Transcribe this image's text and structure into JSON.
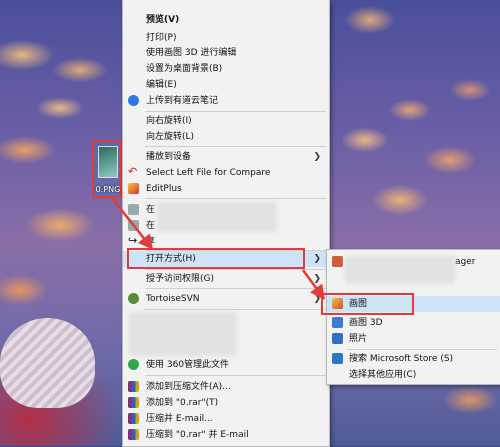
{
  "desktop": {
    "file_name": "0.PNG"
  },
  "context_menu": {
    "items": [
      {
        "label": "预览(V)",
        "bold": true
      },
      {
        "label": "打印(P)"
      },
      {
        "label": "使用画图 3D 进行编辑"
      },
      {
        "label": "设置为桌面背景(B)"
      },
      {
        "label": "编辑(E)"
      },
      {
        "label": "上传到有道云笔记",
        "icon": "youdao-note-icon"
      },
      {
        "label": "向右旋转(I)"
      },
      {
        "label": "向左旋转(L)"
      },
      {
        "label": "播放到设备",
        "submenu": true
      },
      {
        "label": "Select Left File for Compare",
        "icon": "compare-icon"
      },
      {
        "label": "EditPlus",
        "icon": "editplus-icon"
      },
      {
        "label": "在"
      },
      {
        "label": "在"
      },
      {
        "label": "享",
        "icon": "share-icon"
      },
      {
        "label": "打开方式(H)",
        "submenu": true
      },
      {
        "label": "授予访问权限(G)",
        "submenu": true
      },
      {
        "label": "TortoiseSVN",
        "icon": "tortoisesvn-icon",
        "submenu": true
      },
      {
        "label": "使用 360管理此文件",
        "icon": "360-icon"
      },
      {
        "label": "添加到压缩文件(A)...",
        "icon": "winrar-icon"
      },
      {
        "label": "添加到 \"0.rar\"(T)",
        "icon": "winrar-icon"
      },
      {
        "label": "压缩并 E-mail...",
        "icon": "winrar-icon"
      },
      {
        "label": "压缩到 \"0.rar\" 并 E-mail",
        "icon": "winrar-icon"
      }
    ]
  },
  "open_with_submenu": {
    "items": [
      {
        "label": "ager",
        "icon": "app-icon"
      },
      {
        "label": "画图",
        "icon": "paint-icon"
      },
      {
        "label": "画图 3D",
        "icon": "paint3d-icon"
      },
      {
        "label": "照片",
        "icon": "photos-icon"
      },
      {
        "label": "搜索 Microsoft Store (S)",
        "icon": "store-icon"
      },
      {
        "label": "选择其他应用(C)"
      }
    ]
  },
  "highlight_color": "#e23b3b",
  "selection_color": "#cfe3f7"
}
